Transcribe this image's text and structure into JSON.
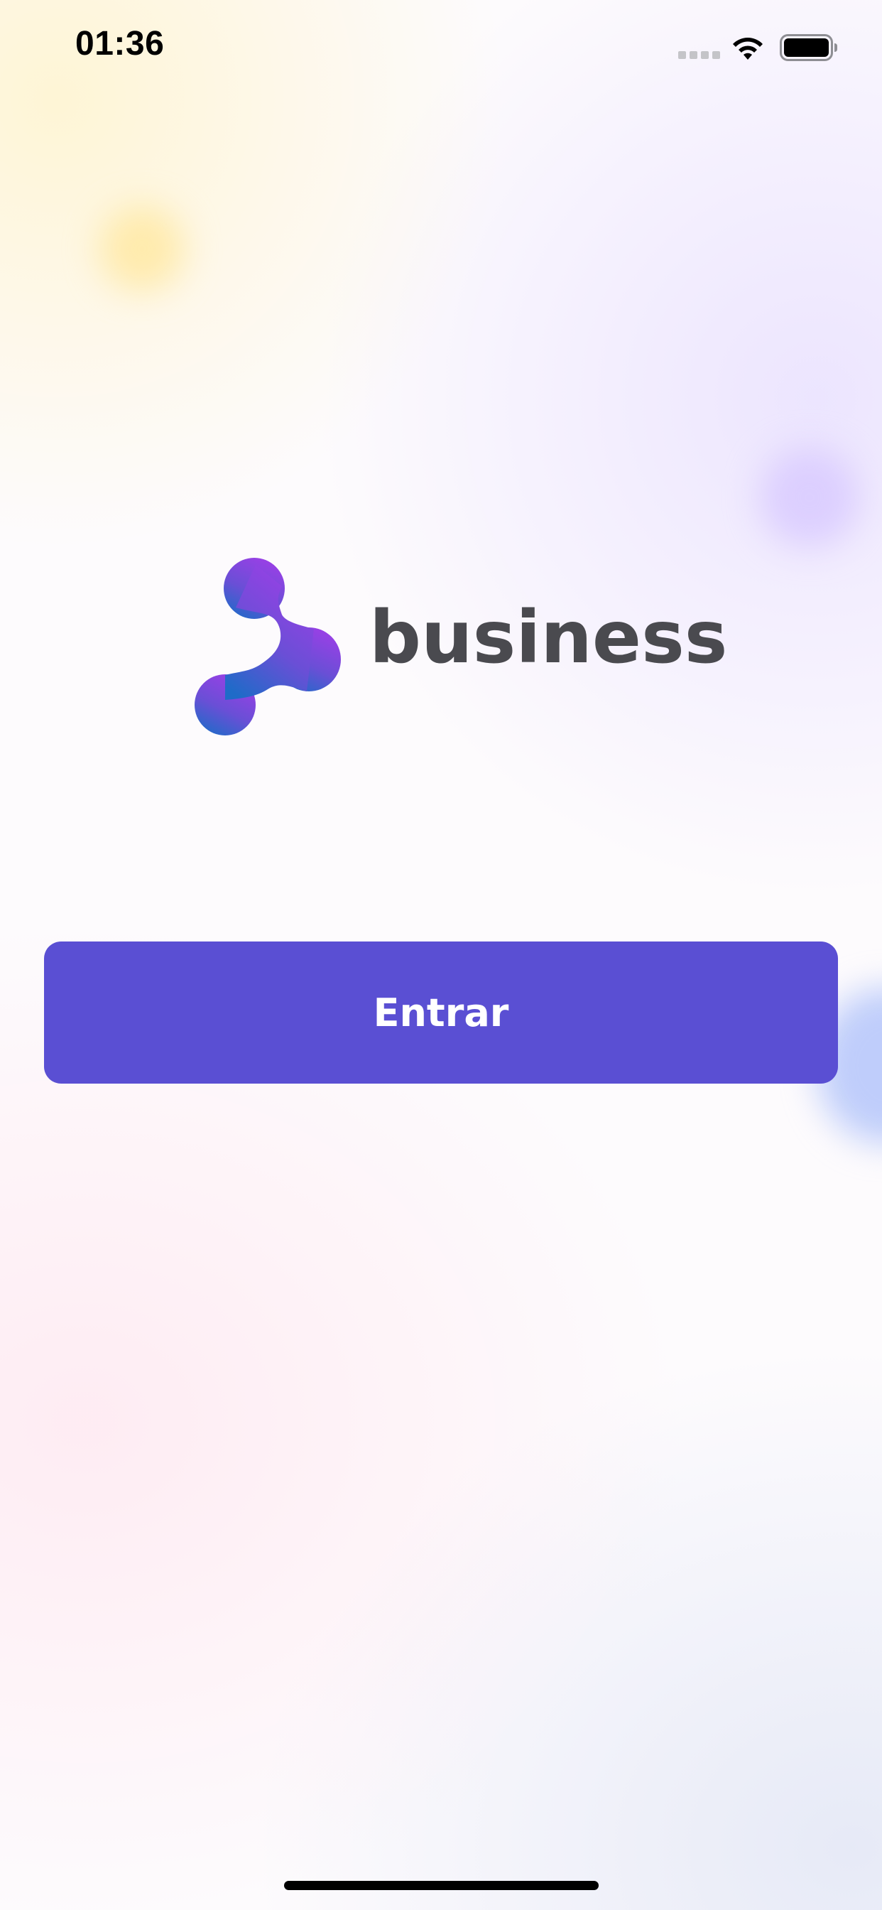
{
  "status_bar": {
    "time": "01:36",
    "icons": [
      "cellular-signal-icon",
      "wifi-icon",
      "battery-icon"
    ]
  },
  "brand": {
    "wordmark": "business",
    "mark_icon": "business-logo-icon",
    "colors": {
      "mark_top": "#9b3fe6",
      "mark_bottom": "#1f6bc8",
      "wordmark": "#4a4a4f"
    }
  },
  "actions": {
    "enter_label": "Entrar",
    "color": "#5a4fd3"
  }
}
